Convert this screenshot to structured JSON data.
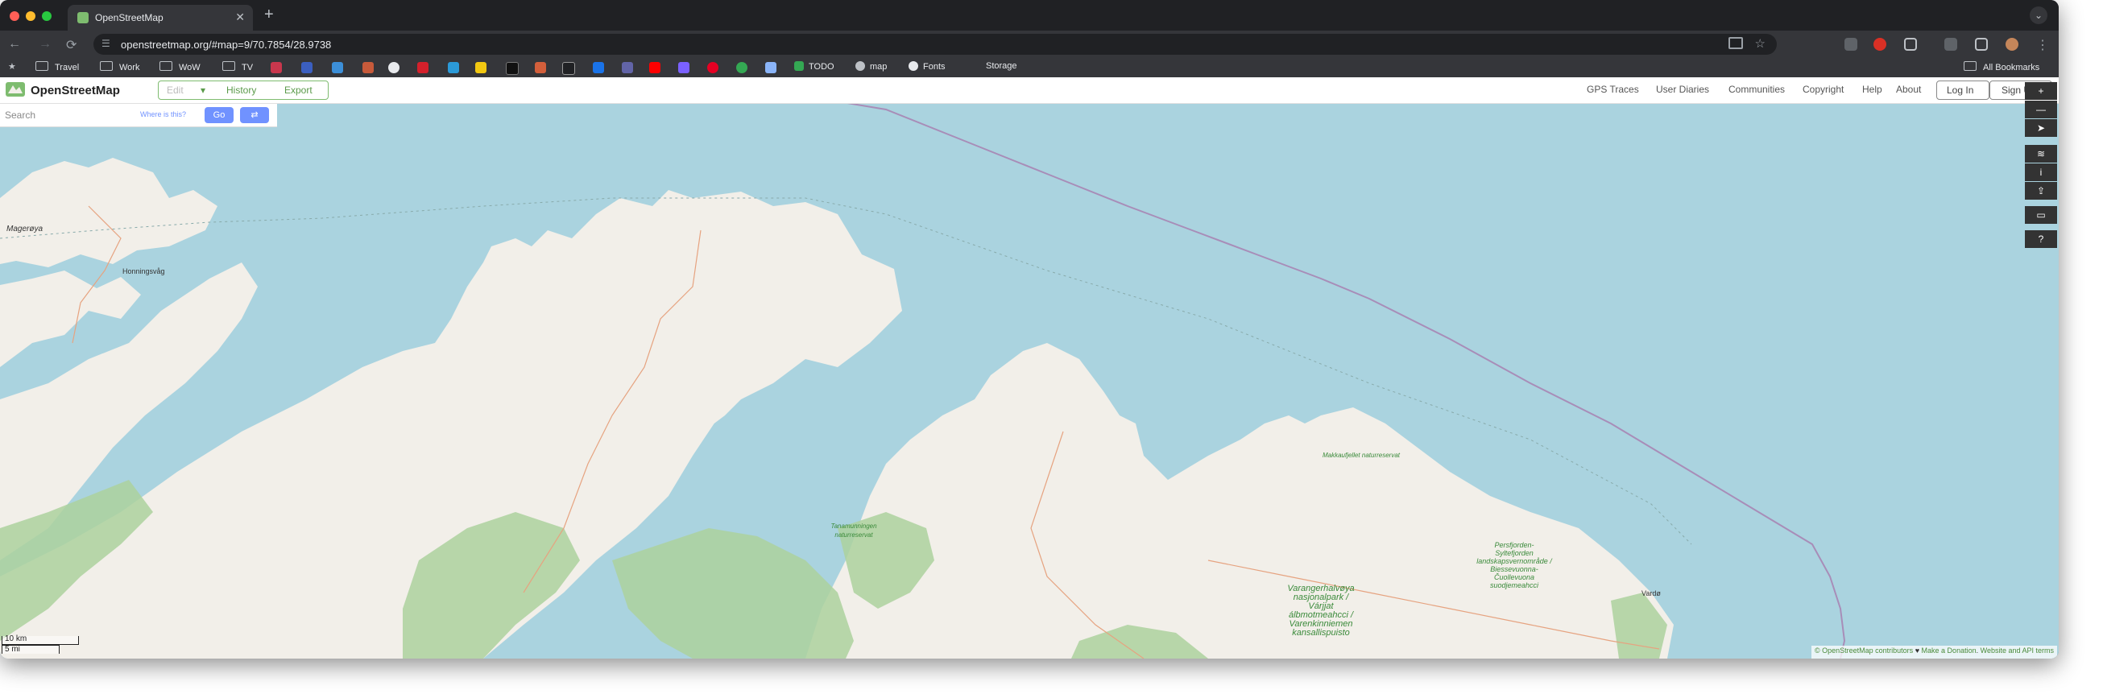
{
  "browser": {
    "tab_title": "OpenStreetMap",
    "tab_close": "✕",
    "new_tab": "+",
    "url": "openstreetmap.org/#map=9/70.7854/28.9738",
    "bookmarks": [
      {
        "label": "Travel",
        "kind": "folder"
      },
      {
        "label": "Work",
        "kind": "folder"
      },
      {
        "label": "WoW",
        "kind": "folder"
      },
      {
        "label": "TV",
        "kind": "folder"
      },
      {
        "label": "TODO",
        "kind": "link"
      },
      {
        "label": "map",
        "kind": "link"
      },
      {
        "label": "Fonts",
        "kind": "link"
      },
      {
        "label": "Storage",
        "kind": "link"
      }
    ],
    "all_bookmarks": "All Bookmarks"
  },
  "osm": {
    "brand": "OpenStreetMap",
    "edit": "Edit",
    "edit_dropdown": "▾",
    "history": "History",
    "export": "Export",
    "nav": [
      "GPS Traces",
      "User Diaries",
      "Communities",
      "Copyright",
      "Help",
      "About"
    ],
    "login": "Log In",
    "signup": "Sign Up",
    "search_placeholder": "Search",
    "where_is_this": "Where is this?",
    "go": "Go",
    "directions_icon": "directions-icon",
    "scale_km": "10 km",
    "scale_mi": "5 mi",
    "attribution": {
      "copyright": "© OpenStreetMap contributors",
      "heart": "♥",
      "donate": "Make a Donation",
      "terms": "Website and API terms"
    }
  },
  "map_labels": {
    "mageroya": "Magerøya",
    "honningsvag": "Honningsvåg",
    "reserve1": "Tanamunningen naturreservat",
    "reserve2": "Makkaufjellet naturreservat",
    "park1": [
      "Varangerhalvøya",
      "nasjonalpark /",
      "Várjjat",
      "álbmotmeahcci /",
      "Varenkinniemen",
      "kansallispuisto"
    ],
    "park2": [
      "Persfjorden-",
      "Syltefjorden",
      "landskapsvernområde /",
      "Biessevuonna-",
      "Čuollevuona",
      "suodjemeahcci"
    ],
    "vardo": "Vardø"
  },
  "colors": {
    "water": "#aad3df",
    "land": "#f2efe9",
    "forest": "#add19e",
    "osm_green": "#7ebc6f",
    "go_button": "#7092ff",
    "maritime_border": "#a88db8"
  }
}
